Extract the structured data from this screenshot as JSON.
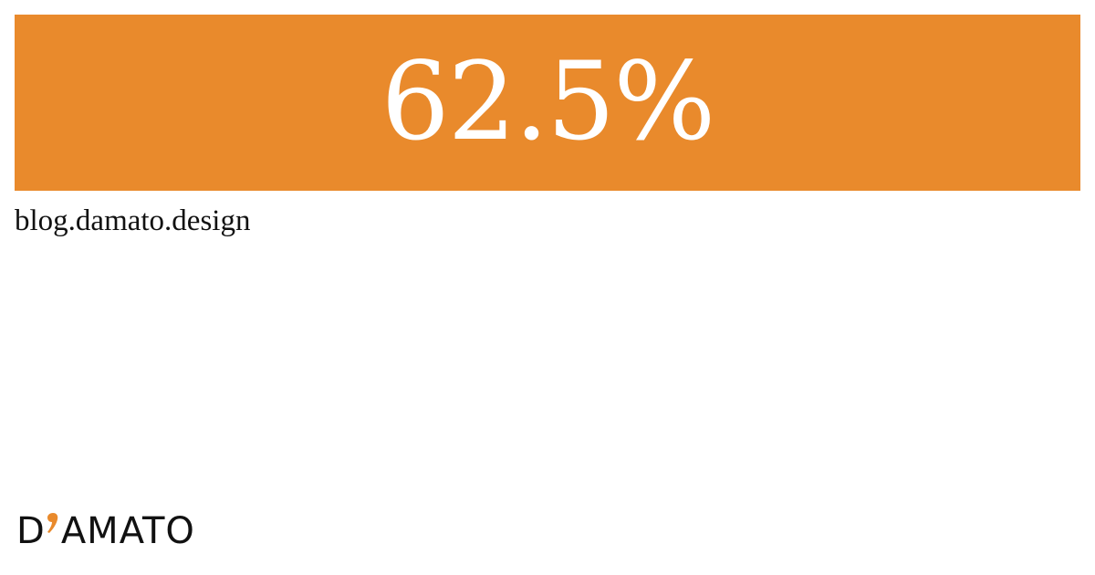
{
  "banner": {
    "headline": "62.5%",
    "background_color": "#E98A2C",
    "text_color": "#FFFFFF"
  },
  "footer": {
    "url": "blog.damato.design"
  },
  "logo": {
    "letter_d": "D",
    "wordmark_rest": "AMATO",
    "apostrophe_color": "#E98A2C",
    "text_color": "#111111",
    "icon": "apostrophe-icon"
  }
}
